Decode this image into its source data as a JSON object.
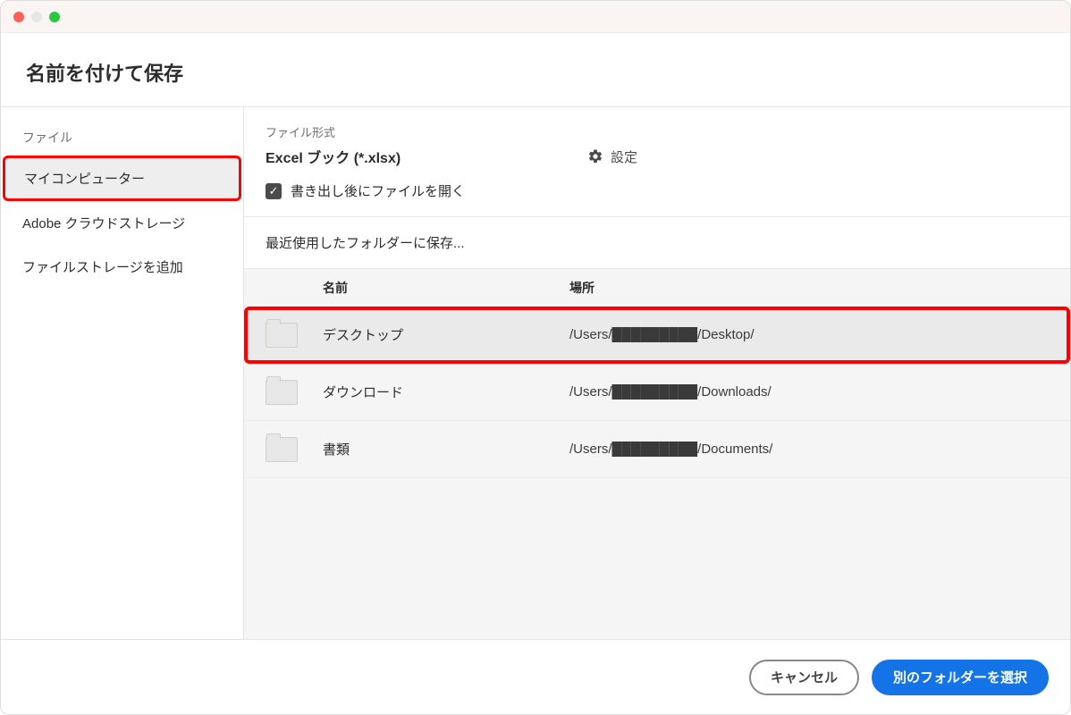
{
  "dialog": {
    "title": "名前を付けて保存"
  },
  "sidebar": {
    "section_label": "ファイル",
    "items": [
      {
        "label": "マイコンピューター",
        "active": true,
        "highlighted": true
      },
      {
        "label": "Adobe クラウドストレージ",
        "active": false,
        "highlighted": false
      },
      {
        "label": "ファイルストレージを追加",
        "active": false,
        "highlighted": false
      }
    ]
  },
  "filetype": {
    "label": "ファイル形式",
    "value": "Excel ブック (*.xlsx)",
    "settings_label": "設定"
  },
  "export": {
    "open_after_label": "書き出し後にファイルを開く",
    "open_after_checked": true
  },
  "recent": {
    "heading": "最近使用したフォルダーに保存...",
    "columns": {
      "name": "名前",
      "location": "場所"
    },
    "rows": [
      {
        "name": "デスクトップ",
        "location": "/Users/█████████/Desktop/",
        "highlighted": true
      },
      {
        "name": "ダウンロード",
        "location": "/Users/█████████/Downloads/",
        "highlighted": false
      },
      {
        "name": "書類",
        "location": "/Users/█████████/Documents/",
        "highlighted": false
      }
    ]
  },
  "buttons": {
    "cancel": "キャンセル",
    "choose_other": "別のフォルダーを選択"
  }
}
